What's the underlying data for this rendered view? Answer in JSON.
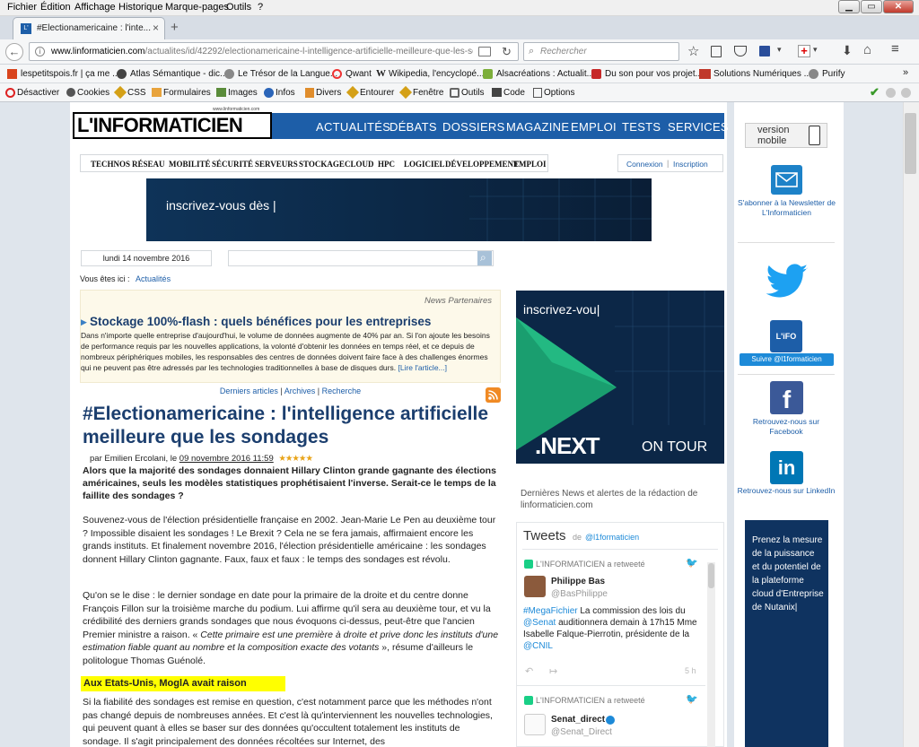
{
  "menu": [
    "Fichier",
    "Édition",
    "Affichage",
    "Historique",
    "Marque-pages",
    "Outils",
    "?"
  ],
  "tab": {
    "title": "#Electionamericaine : l'inte...",
    "close": "×",
    "new": "+"
  },
  "nav": {
    "url_domain": "www.linformaticien.com",
    "url_path": "/actualites/id/42292/electionamericaine-l-intelligence-artificielle-meilleure-que-les-so",
    "search_placeholder": "Rechercher"
  },
  "bookmarks": [
    "lespetitspois.fr | ça me ...",
    "Atlas Sémantique - dic...",
    "Le Trésor de la Langue...",
    "Qwant",
    "Wikipedia, l'encyclopé...",
    "Alsacréations : Actualit...",
    "Du son pour vos projet...",
    "Solutions Numériques ...",
    "Purify"
  ],
  "devtools": [
    "Désactiver",
    "Cookies",
    "CSS",
    "Formulaires",
    "Images",
    "Infos",
    "Divers",
    "Entourer",
    "Fenêtre",
    "Outils",
    "Code",
    "Options"
  ],
  "site": {
    "logo": "L'INFORMATICIEN",
    "logo_url": "www.linformaticien.com",
    "topnav": [
      "ACTUALITÉS",
      "DÉBATS",
      "DOSSIERS",
      "MAGAZINE",
      "EMPLOI",
      "TESTS",
      "SERVICES"
    ],
    "subnav": [
      "TECHNOS",
      "RÉSEAU",
      "MOBILITÉ",
      "SÉCURITÉ",
      "SERVEURS",
      "STOCKAGE",
      "CLOUD",
      "HPC",
      "LOGICIEL",
      "DÉVELOPPEMENT",
      "EMPLOI"
    ],
    "login": "Connexion",
    "signup": "Inscription",
    "banner_text": "inscrivez-vous dès |",
    "date": "lundi 14 novembre 2016",
    "breadcrumb_label": "Vous êtes ici :",
    "breadcrumb_link": "Actualités"
  },
  "partner": {
    "label": "News Partenaires",
    "title": "Stockage 100%-flash : quels bénéfices pour les entreprises",
    "body": "Dans n'importe quelle entreprise d'aujourd'hui, le volume de données augmente de 40% par an. Si l'on ajoute les besoins de performance requis par les nouvelles applications, la volonté d'obtenir les données en temps réel, et ce depuis de nombreux périphériques mobiles, les responsables des centres de données doivent faire face à des challenges énormes qui ne peuvent pas être adressés par les technologies traditionnelles à base de disques durs.",
    "more": "[Lire l'article...]"
  },
  "artnav": [
    "Derniers articles",
    "Archives",
    "Recherche"
  ],
  "article": {
    "title": "#Electionamericaine : l'intelligence artificielle meilleure que les sondages",
    "byline_prefix": "par Emilien Ercolani, le",
    "date": "09 novembre 2016 11:59",
    "lead": "Alors que la majorité des sondages donnaient Hillary Clinton grande gagnante des élections américaines, seuls les modèles statistiques prophétisaient l'inverse. Serait-ce le temps de la faillite des sondages ?",
    "p1": "Souvenez-vous de l'élection présidentielle française en 2002. Jean-Marie Le Pen au deuxième tour ? Impossible disaient les sondages ! Le Brexit ? Cela ne se fera jamais, affirmaient encore les grands instituts. Et finalement novembre 2016, l'élection présidentielle américaine : les sondages donnent Hillary Clinton gagnante. Faux, faux et faux : le temps des sondages est révolu.",
    "p2a": "Qu'on se le dise : le dernier sondage en date pour la primaire de la droite et du centre donne François Fillon sur la troisième marche du podium. Lui affirme qu'il sera au deuxième tour, et vu la crédibilité des derniers grands sondages que nous évoquons ci-dessus, peut-être que l'ancien Premier ministre a raison. «",
    "p2b": "Cette primaire est une première à droite et prive donc les instituts d'une estimation fiable quant au nombre et la composition exacte des votants",
    "p2c": "», résume d'ailleurs le politologue Thomas Guénolé.",
    "subhead": "Aux Etats-Unis, MoglA avait raison",
    "p3": "Si la fiabilité des sondages est remise en question, c'est notamment parce que les méthodes n'ont pas changé depuis de nombreuses années. Et c'est là qu'interviennent les nouvelles technologies, qui peuvent quant à elles se baser sur des données qu'occultent totalement les instituts de sondage. Il s'agit principalement des données récoltées sur Internet, des"
  },
  "ad_right": {
    "top": "inscrivez-vou|",
    "brand": ".NEXT",
    "tail": "ON TOUR"
  },
  "news": {
    "text": "Dernières News et alertes de la rédaction de linformaticien.com"
  },
  "tweets": {
    "title": "Tweets",
    "by": "de",
    "handle": "@l1formaticien",
    "items": [
      {
        "retweet": "L'INFORMATICIEN a retweeté",
        "name": "Philippe Bas",
        "handle": "@BasPhilippe",
        "t1": "#MegaFichier",
        "t2": " La commission des lois du ",
        "t3": "@Senat",
        "t4": " auditionnera demain à 17h15 Mme Isabelle Falque-Pierrotin, présidente de la ",
        "t5": "@CNIL",
        "time": "5 h"
      },
      {
        "retweet": "L'INFORMATICIEN a retweeté",
        "name": "Senat_direct",
        "handle": "@Senat_Direct"
      }
    ]
  },
  "sidebar": {
    "mobile": "version mobile",
    "mobile_1": "version",
    "mobile_2": "mobile",
    "newsletter": "S'abonner à la Newsletter de L'Informaticien",
    "follow": "Suivre @l1formaticien",
    "infologo": "L'iFO",
    "facebook": "Retrouvez-nous sur Facebook",
    "linkedin": "Retrouvez-nous sur LinkedIn",
    "nutanix": "Prenez la mesure de la puissance et du potentiel de la plateforme cloud d'Entreprise de Nutanix|"
  },
  "colors": {
    "brand": "#1d5ea8",
    "title": "#1b3e6e",
    "highlight": "#ffff00"
  }
}
